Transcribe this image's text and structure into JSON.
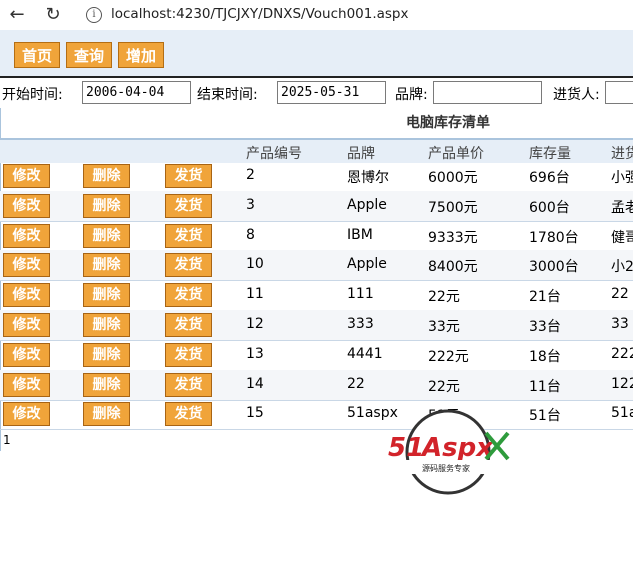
{
  "browser": {
    "url": "localhost:4230/TJCJXY/DNXS/Vouch001.aspx"
  },
  "toolbar": {
    "home": "首页",
    "query": "查询",
    "add": "增加"
  },
  "filter": {
    "start_label": "开始时间:",
    "start_value": "2006-04-04",
    "end_label": "结束时间:",
    "end_value": "2025-05-31",
    "brand_label": "品牌:",
    "brand_value": "",
    "buyer_label": "进货人:",
    "buyer_value": ""
  },
  "table": {
    "title": "电脑库存清单",
    "headers": [
      "产品编号",
      "品牌",
      "产品单价",
      "库存量",
      "进货"
    ],
    "actions": {
      "edit": "修改",
      "delete": "删除",
      "ship": "发货"
    },
    "rows": [
      [
        "2",
        "恩博尔",
        "6000元",
        "696台",
        "小强"
      ],
      [
        "3",
        "Apple",
        "7500元",
        "600台",
        "孟老"
      ],
      [
        "8",
        "IBM",
        "9333元",
        "1780台",
        "健哥"
      ],
      [
        "10",
        "Apple",
        "8400元",
        "3000台",
        "小2"
      ],
      [
        "11",
        "111",
        "22元",
        "21台",
        "22"
      ],
      [
        "12",
        "333",
        "33元",
        "33台",
        "33"
      ],
      [
        "13",
        "4441",
        "222元",
        "18台",
        "222"
      ],
      [
        "14",
        "22",
        "22元",
        "11台",
        "122"
      ],
      [
        "15",
        "51aspx",
        "51元",
        "51台",
        "51a"
      ]
    ],
    "pager": "1"
  },
  "watermark": {
    "brand": "51Aspx",
    "tagline": "源码服务专家"
  }
}
